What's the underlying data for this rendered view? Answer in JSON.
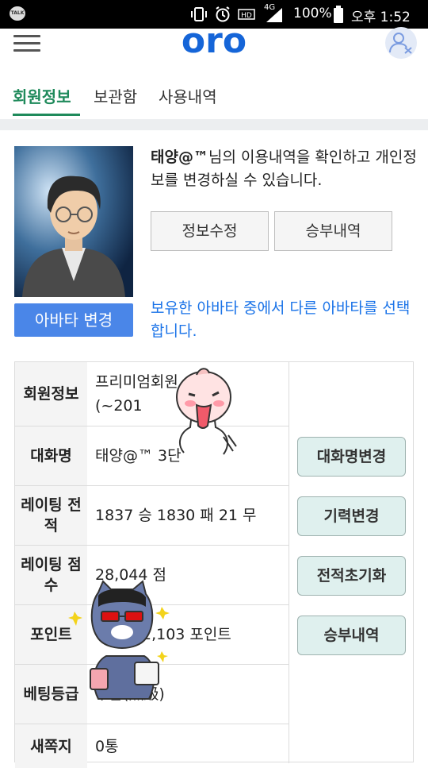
{
  "status_bar": {
    "app_badge": "TALK",
    "network": "4G",
    "battery": "100%",
    "time": "오후 1:52"
  },
  "header": {
    "logo_text": "oro"
  },
  "tabs": [
    {
      "label": "회원정보",
      "active": true
    },
    {
      "label": "보관함",
      "active": false
    },
    {
      "label": "사용내역",
      "active": false
    }
  ],
  "profile": {
    "nickname": "태양@™",
    "intro_suffix": "님의 이용내역을 확인하고 개인정보를 변경하실 수 있습니다.",
    "edit_button": "정보수정",
    "record_button": "승부내역",
    "avatar_button": "아바타 변경",
    "avatar_note": "보유한 아바타 중에서 다른 아바타를 선택 합니다."
  },
  "info_table": [
    {
      "label": "회원정보",
      "value": "프리미엄회원 (~201"
    },
    {
      "label": "대화명",
      "value": "태양@™  3단"
    },
    {
      "label": "레이팅 전적",
      "value": "1837 승 1830 패 21 무"
    },
    {
      "label": "레이팅 점수",
      "value": "28,044 점"
    },
    {
      "label": "포인트",
      "value": "2,103 포인트"
    },
    {
      "label": "베팅등급",
      "value": "무급(無級)"
    },
    {
      "label": "새쪽지",
      "value": "0통"
    }
  ],
  "side_buttons": {
    "rename": "대화명변경",
    "rating_change": "기력변경",
    "reset_record": "전적초기화",
    "record_history": "승부내역"
  },
  "icons": [
    "talk-icon",
    "vibrate-icon",
    "alarm-icon",
    "hd-icon",
    "signal-icon",
    "battery-icon",
    "menu-icon",
    "user-icon"
  ],
  "colors": {
    "accent_green": "#1f8a5b",
    "avatar_blue": "#4a86e8",
    "note_blue": "#1a73e8",
    "logo_blue": "#1565d8"
  }
}
